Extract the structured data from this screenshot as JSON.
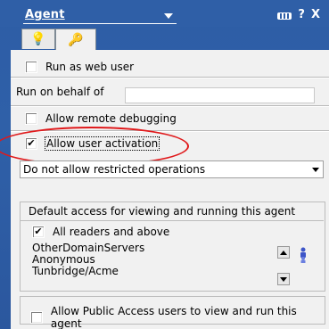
{
  "window": {
    "title": "Agent",
    "controls": {
      "pin_icon": "pin-icon",
      "help": "?",
      "close": "X"
    }
  },
  "tabs": [
    {
      "icon": "lightbulb-icon",
      "glyph": "💡",
      "selected": false
    },
    {
      "icon": "key-icon",
      "glyph": "🔑",
      "selected": true
    }
  ],
  "options": {
    "run_as_web_user": {
      "label": "Run as web user",
      "checked": false
    },
    "run_on_behalf_of": {
      "label": "Run on behalf of",
      "value": ""
    },
    "allow_remote_debugging": {
      "label": "Allow remote debugging",
      "checked": false
    },
    "allow_user_activation": {
      "label": "Allow user activation",
      "checked": true,
      "mark": "✔"
    },
    "restricted_operations": {
      "value": "Do not allow restricted operations"
    }
  },
  "access": {
    "heading": "Default access for viewing and running this agent",
    "all_readers": {
      "label": "All readers and above",
      "checked": true,
      "mark": "✔"
    },
    "list": [
      "OtherDomainServers",
      "Anonymous",
      "Tunbridge/Acme"
    ],
    "people_icon": "people-picker-icon"
  },
  "public_access": {
    "label": "Allow Public Access users to view and run this agent",
    "checked": false
  },
  "colors": {
    "title_bar": "#2f5fa7",
    "panel": "#f1f1f1",
    "annotation": "#e0191b"
  }
}
